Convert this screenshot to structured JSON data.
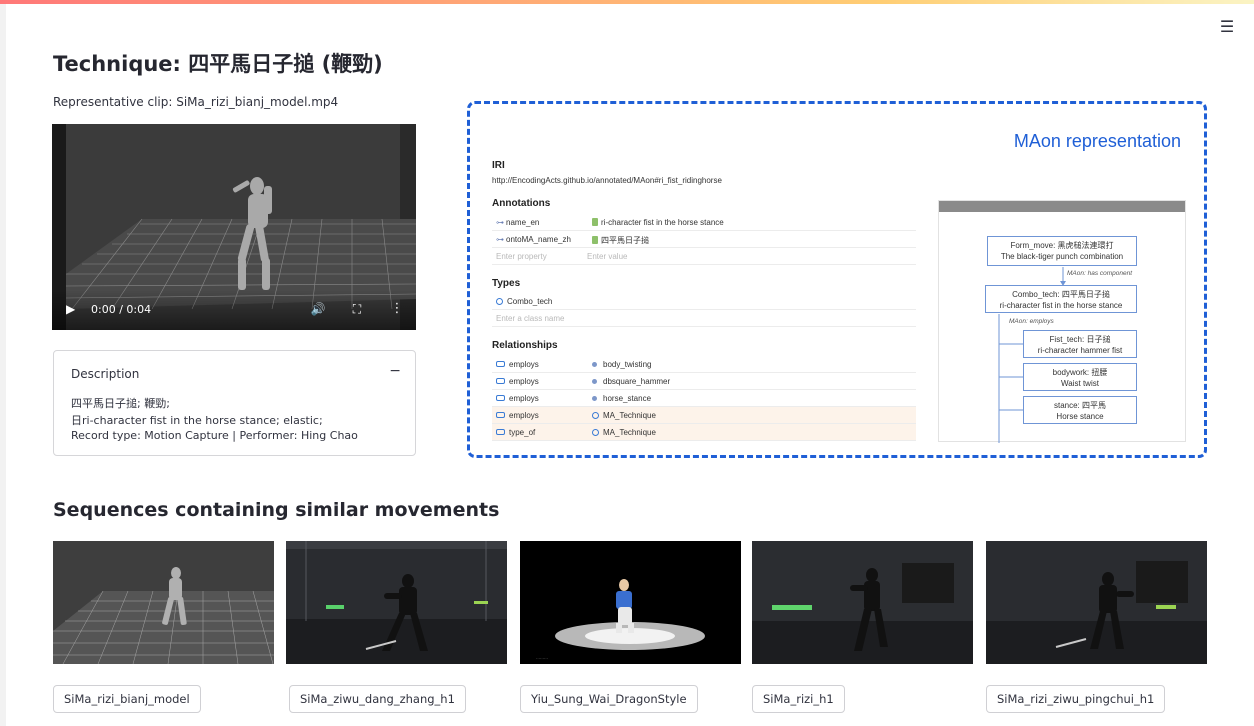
{
  "page": {
    "title": "Technique: 四平馬日子搥 (鞭勁)",
    "clip_caption": "Representative clip: SiMa_rizi_bianj_model.mp4",
    "menu_icon": "hamburger-icon"
  },
  "video": {
    "time": "0:00 / 0:04",
    "icons": [
      "play-icon",
      "volume-icon",
      "fullscreen-icon",
      "more-icon"
    ]
  },
  "description": {
    "header": "Description",
    "toggle": "−",
    "line1": "四平馬日子搥; 鞭勁;",
    "line2": "日ri-character fist in the horse stance; elastic;",
    "line3": "Record type: Motion Capture | Performer: Hing Chao"
  },
  "maon": {
    "title": "MAon representation",
    "iri_label": "IRI",
    "iri": "http://EncodingActs.github.io/annotated/MAon#ri_fist_ridinghorse",
    "annotations_label": "Annotations",
    "annotations": [
      {
        "property": "name_en",
        "value": "ri-character fist in the horse stance"
      },
      {
        "property": "ontoMA_name_zh",
        "value": "四平馬日子搥"
      }
    ],
    "enter_property": "Enter property",
    "enter_value": "Enter value",
    "types_label": "Types",
    "types": [
      "Combo_tech"
    ],
    "enter_class": "Enter a class name",
    "relationships_label": "Relationships",
    "relationships": [
      {
        "property": "employs",
        "value": "body_twisting",
        "kind": "individual"
      },
      {
        "property": "employs",
        "value": "dbsquare_hammer",
        "kind": "individual"
      },
      {
        "property": "employs",
        "value": "horse_stance",
        "kind": "individual"
      },
      {
        "property": "employs",
        "value": "MA_Technique",
        "kind": "class"
      },
      {
        "property": "type_of",
        "value": "MA_Technique",
        "kind": "class"
      }
    ],
    "diagram": {
      "nodes": [
        {
          "line1": "Form_move: 黑虎槌法連環打",
          "line2": "The black-tiger punch combination"
        },
        {
          "line1": "Combo_tech: 四平馬日子搥",
          "line2": "ri-character fist in the horse stance"
        },
        {
          "line1": "Fist_tech: 日子搥",
          "line2": "ri-character hammer fist"
        },
        {
          "line1": "bodywork: 扭腰",
          "line2": "Waist twist"
        },
        {
          "line1": "stance: 四平馬",
          "line2": "Horse stance"
        }
      ],
      "edge_has_component": "MAon: has component",
      "edge_employs": "MAon: employs"
    }
  },
  "similar": {
    "title": "Sequences containing similar movements",
    "items": [
      {
        "label": "SiMa_rizi_bianj_model"
      },
      {
        "label": "SiMa_ziwu_dang_zhang_h1"
      },
      {
        "label": "Yiu_Sung_Wai_DragonStyle"
      },
      {
        "label": "SiMa_rizi_h1"
      },
      {
        "label": "SiMa_rizi_ziwu_pingchui_h1"
      }
    ]
  }
}
